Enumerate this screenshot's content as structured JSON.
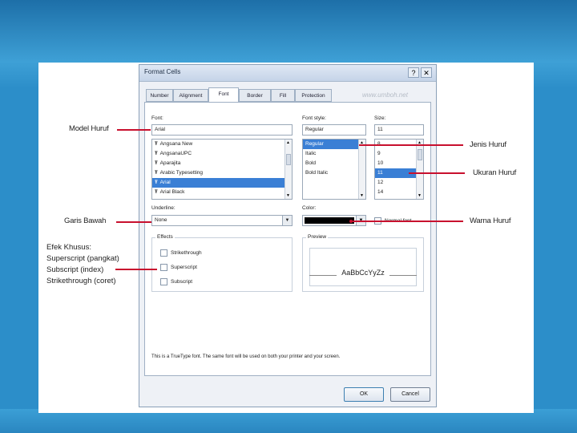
{
  "dialog": {
    "title": "Format Cells",
    "watermark": "www.umboh.net",
    "title_buttons": [
      "?",
      "✕"
    ]
  },
  "tabs": [
    "Number",
    "Alignment",
    "Font",
    "Border",
    "Fill",
    "Protection"
  ],
  "active_tab": "Font",
  "font": {
    "label": "Font:",
    "value": "Arial",
    "list": [
      "Angsana New",
      "AngsanaUPC",
      "Aparajita",
      "Arabic Typesetting",
      "Arial",
      "Arial Black"
    ],
    "selected": "Arial"
  },
  "font_style": {
    "label": "Font style:",
    "value": "Regular",
    "list": [
      "Regular",
      "Italic",
      "Bold",
      "Bold Italic"
    ],
    "selected": "Regular"
  },
  "size": {
    "label": "Size:",
    "value": "11",
    "list": [
      "8",
      "9",
      "10",
      "11",
      "12",
      "14"
    ],
    "selected": "11"
  },
  "underline": {
    "label": "Underline:",
    "value": "None"
  },
  "color": {
    "label": "Color:",
    "value_color": "#000000",
    "normal_font": "Normal font"
  },
  "effects": {
    "label": "Effects",
    "items": [
      "Strikethrough",
      "Superscript",
      "Subscript"
    ]
  },
  "preview": {
    "label": "Preview",
    "sample": "AaBbCcYyZz"
  },
  "note": "This is a TrueType font. The same font will be used on both your printer and your screen.",
  "buttons": {
    "ok": "OK",
    "cancel": "Cancel"
  },
  "annotations": {
    "model_huruf": "Model Huruf",
    "garis_bawah": "Garis Bawah",
    "efek_khusus": [
      "Efek Khusus:",
      "Superscript (pangkat)",
      "Subscript (index)",
      "Strikethrough (coret)"
    ],
    "jenis_huruf": "Jenis Huruf",
    "ukuran_huruf": "Ukuran Huruf",
    "warna_huruf": "Warna Huruf"
  },
  "colors": {
    "annotation_line": "#c8102e",
    "selection": "#3a7fd5",
    "background_blue": "#2c8ec9"
  }
}
